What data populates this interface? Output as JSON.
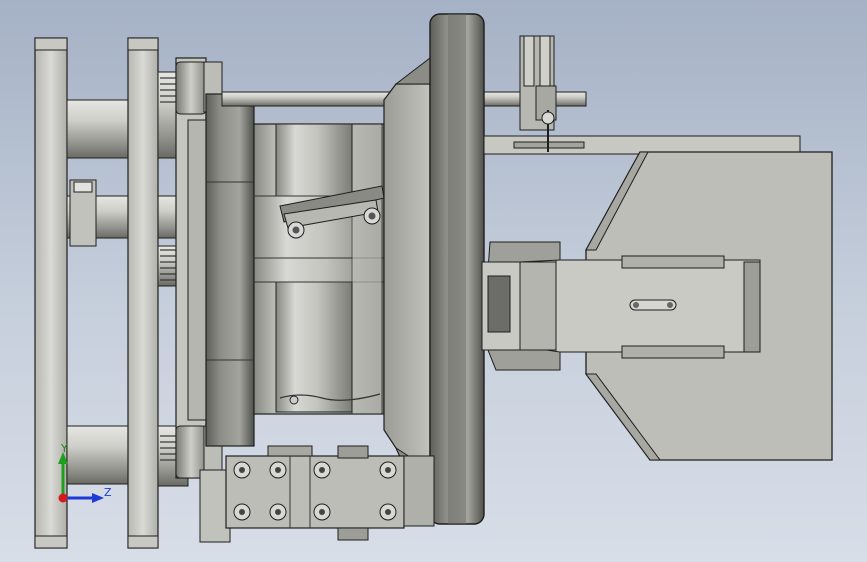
{
  "viewport": {
    "background_top": "#a5b1c5",
    "background_bottom": "#d8dee8"
  },
  "colors": {
    "metal_light": "#d6d6d2",
    "metal_mid": "#b4b4ae",
    "metal_dark": "#6e6e6a",
    "edge": "#1e1e1e",
    "axis_x": "#d41b1b",
    "axis_y": "#1ea01e",
    "axis_z": "#1c3bd6"
  },
  "triad": {
    "y_label": "Y",
    "z_label": "Z",
    "x_icon": "x-axis-arrow-icon",
    "y_icon": "y-axis-arrow-icon",
    "z_icon": "z-axis-arrow-icon"
  }
}
